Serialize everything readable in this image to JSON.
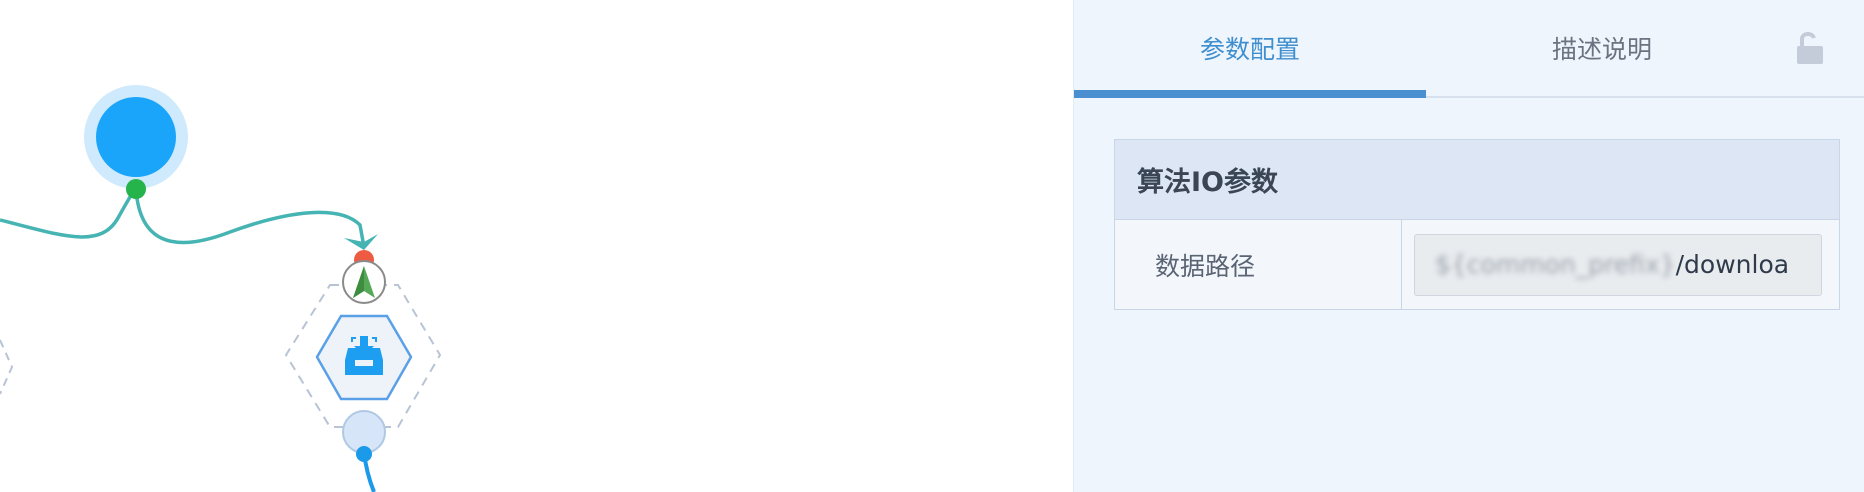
{
  "canvas": {
    "colors": {
      "edge": "#45b4b3",
      "start_node": "#1aa5fb",
      "start_halo": "#cfeafc",
      "output_port": "#25b34b",
      "input_port": "#ed5b42",
      "component_border": "#5aa0e6",
      "component_fill": "#eef3fa",
      "component_icon": "#1d9ef0",
      "hex_outline": "#b8c4d4",
      "bottom_port": "#d6e6f8",
      "bottom_link": "#1a9ae8"
    },
    "nodes": [
      {
        "id": "start-node",
        "icon": "circle"
      },
      {
        "id": "data-download-component",
        "icon": "inbox-download-icon",
        "status_icon": "navigation-arrow-icon"
      }
    ]
  },
  "panel": {
    "tabs": [
      {
        "label": "参数配置",
        "active": true
      },
      {
        "label": "描述说明",
        "active": false
      }
    ],
    "lock_icon": "unlock-icon",
    "section_title": "算法IO参数",
    "rows": [
      {
        "label": "数据路径",
        "value_blurred": "${common_prefix}",
        "value_visible": "/downloa"
      }
    ]
  }
}
